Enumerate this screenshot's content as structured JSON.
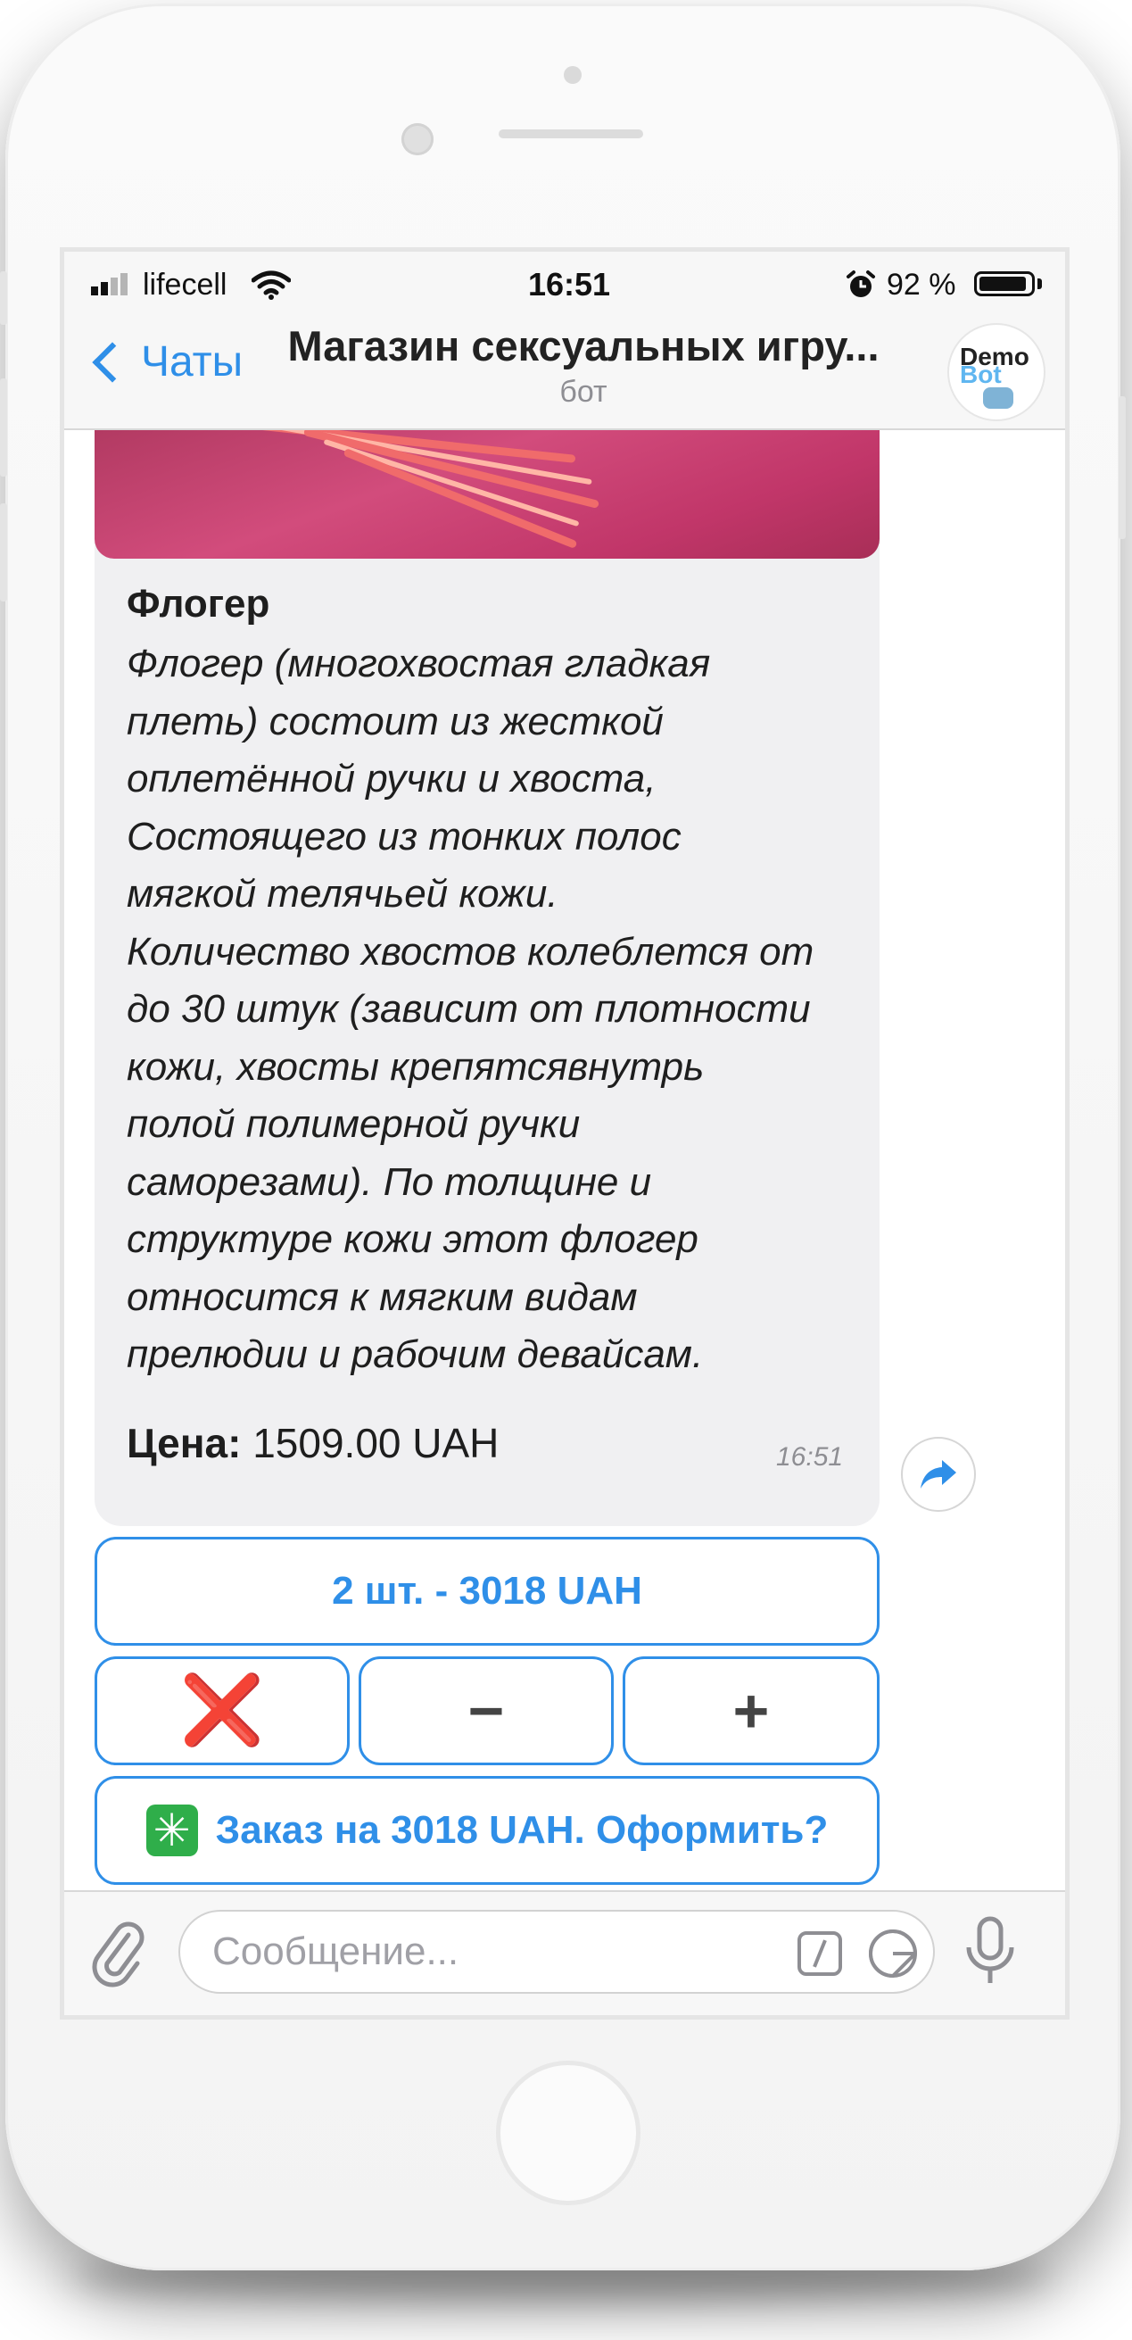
{
  "status_bar": {
    "carrier": "lifecell",
    "time": "16:51",
    "battery_percent": "92 %",
    "battery_level": 0.92,
    "icons": [
      "signal-icon",
      "wifi-icon",
      "alarm-icon",
      "battery-icon"
    ]
  },
  "nav": {
    "back_label": "Чаты",
    "title": "Магазин сексуальных игру...",
    "subtitle": "бот",
    "avatar": {
      "line1": "Demo",
      "line2": "Bot"
    }
  },
  "message": {
    "title": "Флогер",
    "description": "Флогер (многохвостая гладкая\nплеть) состоит из жесткой\nоплетённой ручки и хвоста,\nСостоящего из тонких полос\nмягкой телячьей кожи.\nКоличество хвостов колеблется от\nдо 30 штук (зависит от плотности\nкожи, хвосты крепятсявнутрь\nполой полимерной  ручки\nсаморезами). По толщине и\nструктуре кожи этот флогер\nотносится к мягким видам\nпрелюдии и рабочим девайсам.",
    "price_label": "Цена:",
    "price_value": " 1509.00 UAH",
    "time": "16:51"
  },
  "keyboard": {
    "quantity": "2 шт. - 3018 UAH",
    "remove": "❌",
    "minus": "−",
    "plus": "+",
    "order_icon": "✳",
    "order": "Заказ на 3018 UAH. Оформить?"
  },
  "input": {
    "placeholder": "Сообщение..."
  },
  "colors": {
    "accent": "#2f8fe8",
    "remove": "#e0131d",
    "order_icon_bg": "#2fae4a",
    "bubble": "#f0f0f2"
  }
}
